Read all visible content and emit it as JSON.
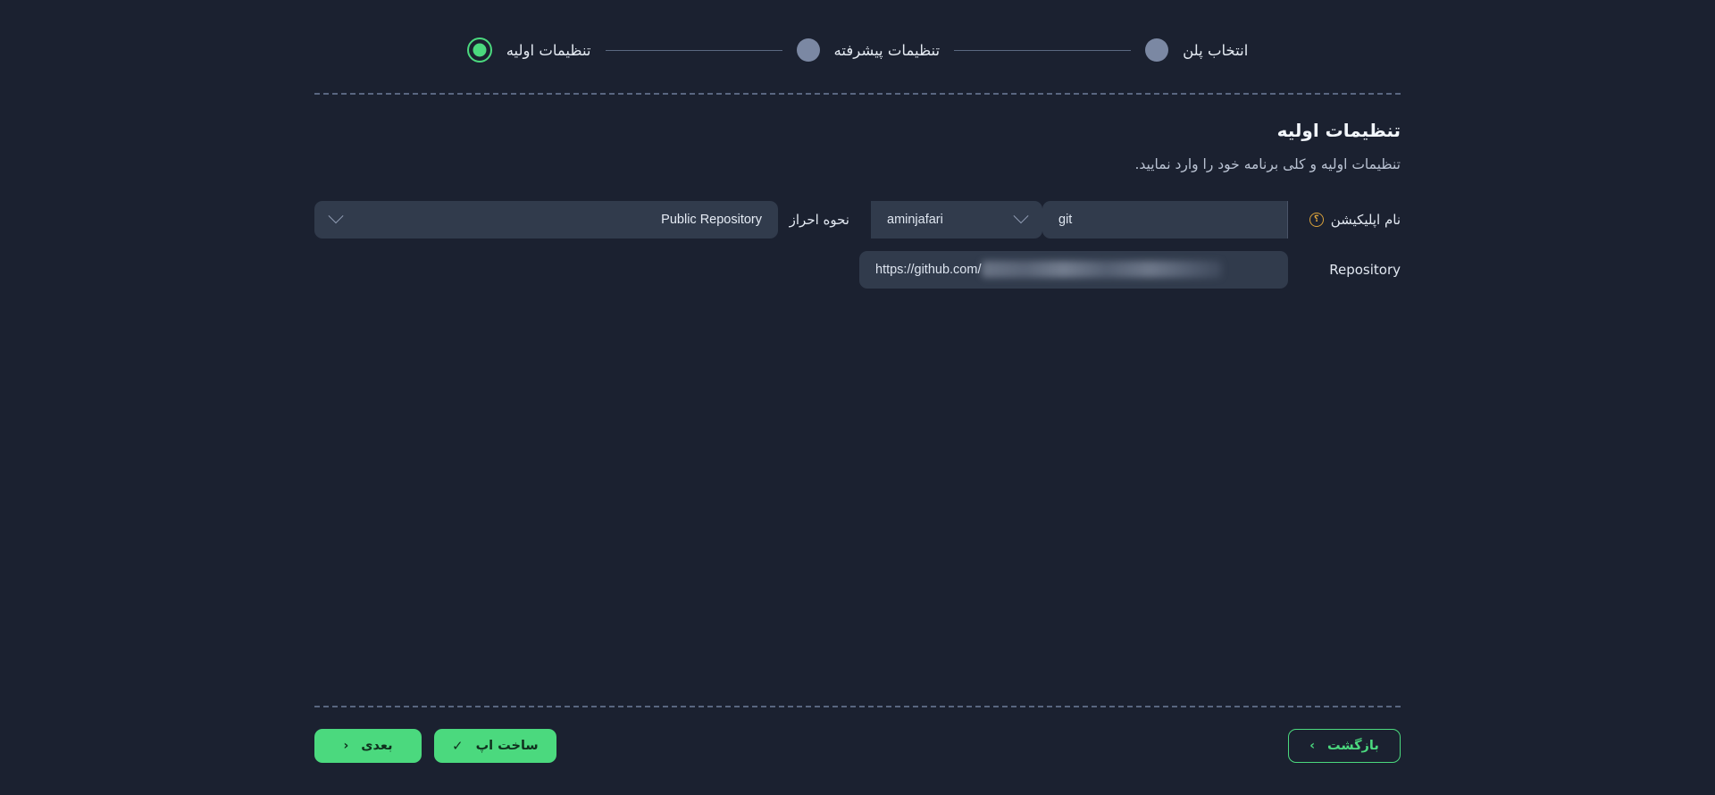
{
  "stepper": {
    "steps": [
      {
        "label": "انتخاب پلن",
        "state": "inactive",
        "dot": "step-dot-plan"
      },
      {
        "label": "تنظیمات پیشرفته",
        "state": "inactive",
        "dot": "step-dot-advanced"
      },
      {
        "label": "تنظیمات اولیه",
        "state": "active",
        "dot": "step-dot-initial"
      }
    ]
  },
  "header": {
    "title": "تنظیمات اولیه",
    "subtitle": "تنظیمات اولیه و کلی برنامه خود را وارد نمایید."
  },
  "form": {
    "app_name": {
      "label": "نام اپلیکیشن",
      "help_icon": "question-circle-icon",
      "help_glyph": "؟",
      "value": "git",
      "placeholder": "نام اپلیکیشن"
    },
    "owner": {
      "value": "aminjafari",
      "chevron_icon": "chevron-down-icon"
    },
    "auth": {
      "label": "نحوه احراز",
      "value": "Public Repository",
      "chevron_icon": "chevron-down-icon"
    },
    "repository": {
      "label": "Repository",
      "prefix": "https://github.com/",
      "value": "",
      "redacted": true,
      "placeholder": "https://github.com/"
    }
  },
  "footer": {
    "next": {
      "label": "بعدی",
      "icon": "chevron-left-icon",
      "glyph": "‹"
    },
    "build": {
      "label": "ساخت اپ",
      "icon": "check-icon",
      "glyph": "✓"
    },
    "back": {
      "label": "بازگشت",
      "icon": "chevron-right-icon",
      "glyph": "›"
    }
  },
  "colors": {
    "background": "#1b2130",
    "surface": "#313b4c",
    "accent_green": "#4bd97e",
    "muted": "#7b88a3",
    "help_orange": "#d8a13c",
    "divider": "#596680"
  }
}
